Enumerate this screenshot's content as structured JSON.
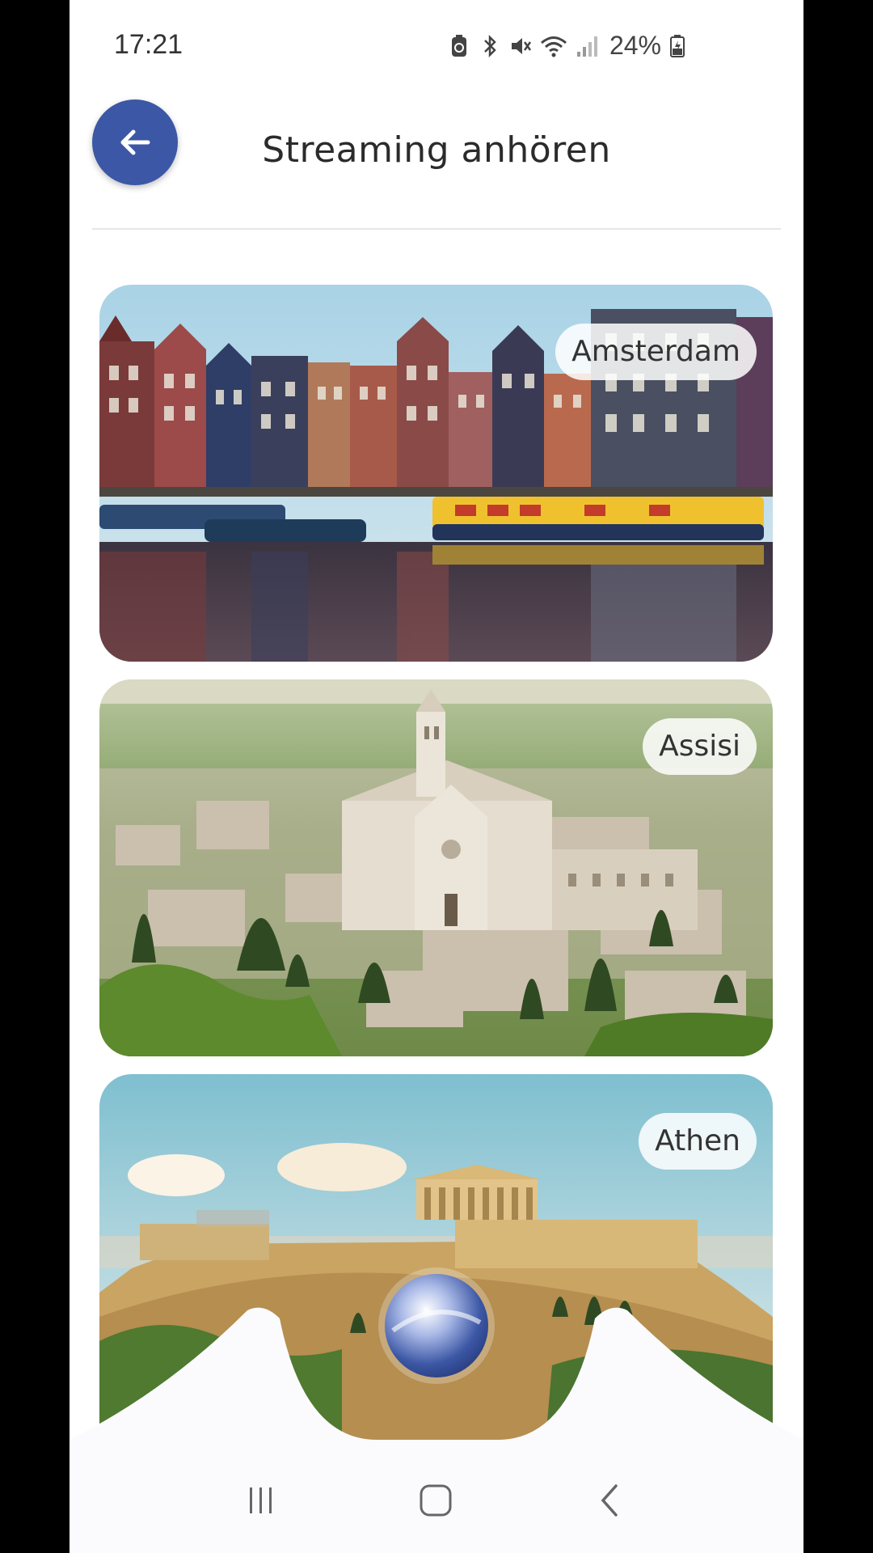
{
  "status": {
    "time": "17:21",
    "battery": "24%",
    "icons": [
      "battery-saver-icon",
      "bluetooth-icon",
      "mute-icon",
      "wifi-icon",
      "signal-icon",
      "battery-icon"
    ]
  },
  "header": {
    "title": "Streaming anhören",
    "back_icon": "arrow-left-icon"
  },
  "cities": [
    {
      "name": "Amsterdam"
    },
    {
      "name": "Assisi"
    },
    {
      "name": "Athen"
    }
  ],
  "nav": {
    "items": [
      "recent-apps-icon",
      "home-icon",
      "back-nav-icon"
    ]
  },
  "colors": {
    "accent": "#3c57a5",
    "background": "#ffffff"
  }
}
